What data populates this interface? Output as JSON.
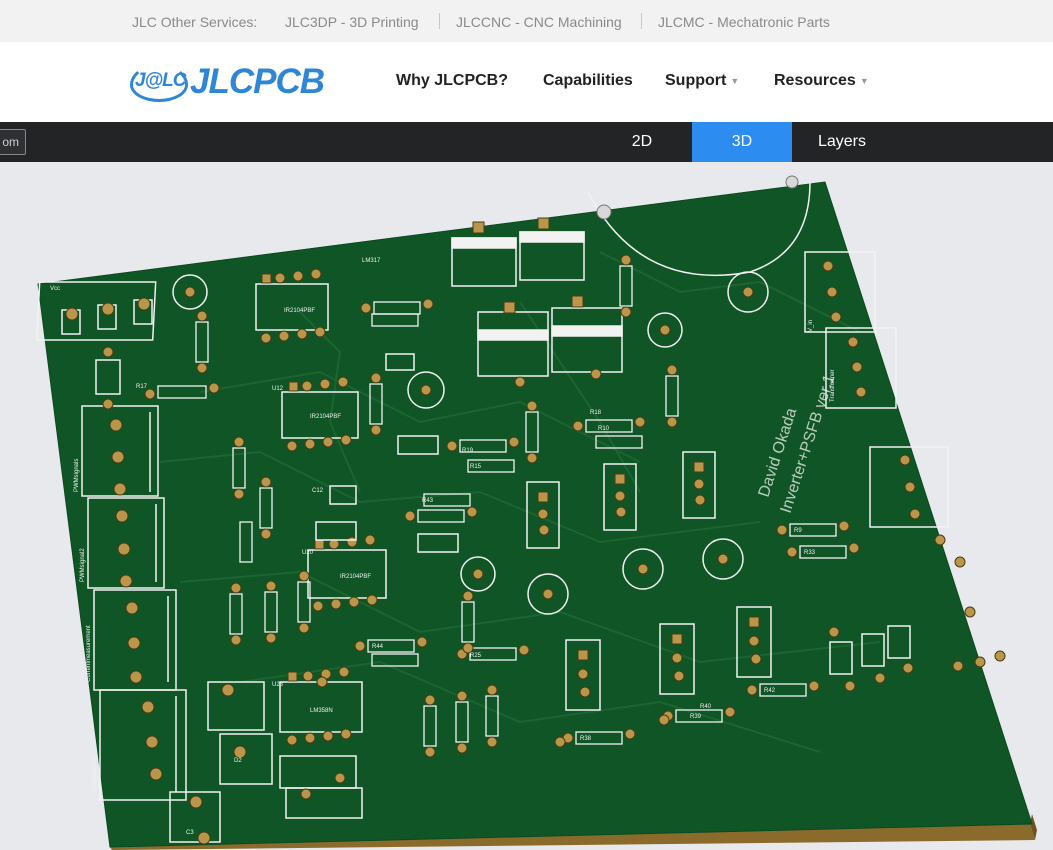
{
  "top_bar": {
    "label": "JLC Other Services:",
    "links": [
      "JLC3DP - 3D Printing",
      "JLCCNC - CNC Machining",
      "JLCMC - Mechatronic Parts"
    ]
  },
  "header": {
    "logo_badge": "J@LC",
    "logo_text": "JLCPCB",
    "nav": [
      "Why JLCPCB?",
      "Capabilities",
      "Support",
      "Resources"
    ]
  },
  "toolbar": {
    "zoom_label": "om",
    "tabs": [
      "2D",
      "3D",
      "Layers"
    ],
    "active_tab": "3D"
  },
  "board": {
    "silkscreen_title": "David Okada",
    "silkscreen_subtitle": "Inverter+PSFB ver.1",
    "connector_labels": [
      "Vcc",
      "PWMsignals",
      "PWMsignal2",
      "Currentmeasurement",
      "Voltagesense",
      "V_in",
      "Transformer"
    ],
    "components": [
      "U1",
      "U2",
      "U11",
      "U12",
      "U13",
      "U19",
      "U20",
      "U21",
      "U22",
      "U23",
      "LM317",
      "LM358N",
      "IR2104PBF",
      "R17",
      "R18",
      "R19",
      "R10",
      "R15",
      "R25",
      "R33",
      "R38",
      "R39",
      "R40",
      "R42",
      "R43",
      "R44",
      "R9",
      "C3",
      "C11",
      "C12",
      "C13",
      "C23",
      "D2"
    ],
    "colors": {
      "solder_mask": "#0f5525",
      "silkscreen": "#f2f2f2",
      "pad": "#b9964a",
      "board_edge": "#8a6b2c"
    }
  }
}
